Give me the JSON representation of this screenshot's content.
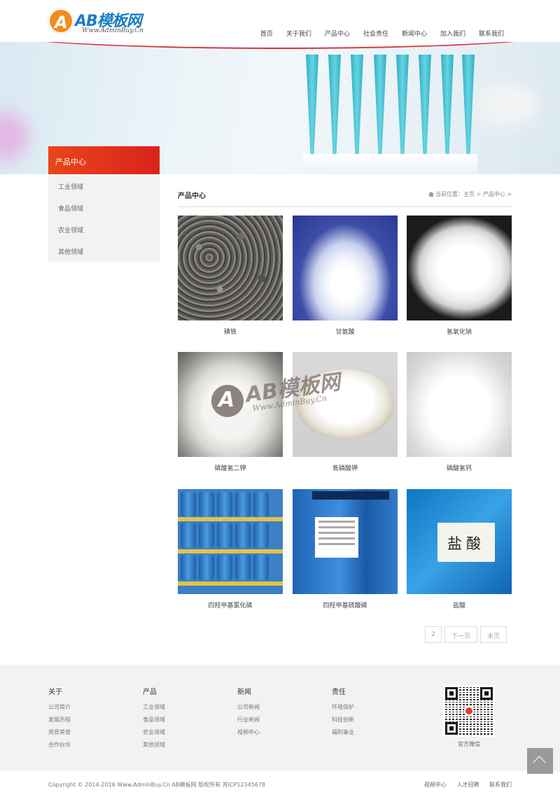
{
  "header": {
    "logo_name": "AB模板网",
    "logo_sub": "Www.AdminBuy.Cn",
    "nav": [
      "首页",
      "关于我们",
      "产品中心",
      "社会责任",
      "新闻中心",
      "加入我们",
      "联系我们"
    ]
  },
  "sidebar": {
    "title": "产品中心",
    "items": [
      "工业领域",
      "食品领域",
      "农业领域",
      "其他领域"
    ]
  },
  "main": {
    "title": "产品中心",
    "breadcrumb": {
      "prefix": "当前位置：",
      "items": [
        "主页",
        "产品中心"
      ],
      "separator": ">"
    },
    "products": [
      {
        "name": "碘铁"
      },
      {
        "name": "甘氨酸"
      },
      {
        "name": "氢氧化钠"
      },
      {
        "name": "磷酸氢二钾"
      },
      {
        "name": "焦磷酸钾"
      },
      {
        "name": "磷酸氢钙"
      },
      {
        "name": "四羟甲基氯化磷"
      },
      {
        "name": "四羟甲基硫酸磷"
      },
      {
        "name": "盐酸"
      }
    ],
    "hcl_label": "盐酸",
    "watermark": {
      "name": "AB模板网",
      "sub": "Www.AdminBuy.Cn"
    },
    "pager": {
      "page": "2",
      "next": "下一页",
      "last": "末页"
    }
  },
  "footer": {
    "columns": [
      {
        "title": "关于",
        "links": [
          "公司简介",
          "发展历程",
          "资质荣誉",
          "合作伙伴"
        ]
      },
      {
        "title": "产品",
        "links": [
          "工业领域",
          "食品领域",
          "农业领域",
          "其他领域"
        ]
      },
      {
        "title": "新闻",
        "links": [
          "公司新闻",
          "行业新闻",
          "视频中心"
        ]
      },
      {
        "title": "责任",
        "links": [
          "环境保护",
          "科技创新",
          "福利事业"
        ]
      }
    ],
    "qr_caption": "官方微信",
    "copyright": "Copyright © 2014-2016 Www.AdminBuy.Cn AB模板网 版权所有   苏ICP12345678",
    "links": [
      "视频中心",
      "人才招聘",
      "联系我们"
    ]
  },
  "colors": {
    "accent": "#d9231c",
    "brand_blue": "#1b7dc6",
    "logo_orange": "#f08c1e"
  }
}
